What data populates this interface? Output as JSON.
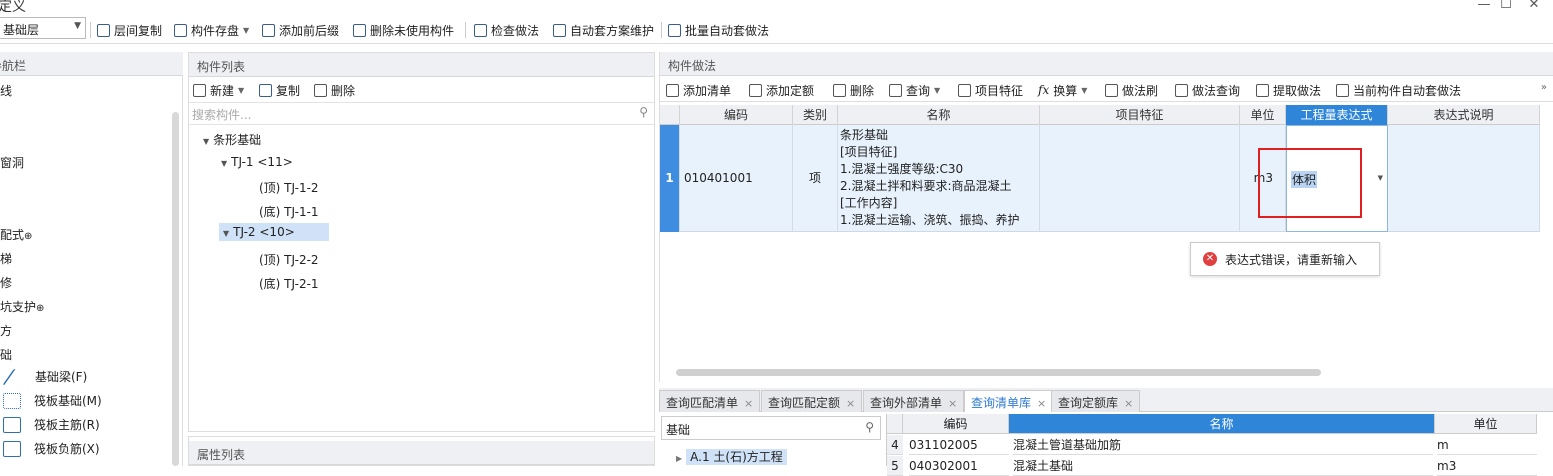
{
  "window": {
    "title": "定义"
  },
  "toolbar": {
    "floor": "基础层",
    "items": [
      "层间复制",
      "构件存盘",
      "添加前后缀",
      "删除未使用构件",
      "检查做法",
      "自动套方案维护",
      "批量自动套做法"
    ]
  },
  "nav": {
    "title": "导航栏",
    "items": [
      "线",
      "窗洞",
      "配式",
      "梯",
      "修",
      "坑支护",
      "方",
      "础"
    ],
    "sub_items": [
      "基础梁(F)",
      "筏板基础(M)",
      "筏板主筋(R)",
      "筏板负筋(X)"
    ]
  },
  "component_list": {
    "title": "构件列表",
    "new_label": "新建",
    "copy_label": "复制",
    "delete_label": "删除",
    "search_placeholder": "搜索构件...",
    "tree": {
      "root": "条形基础",
      "tj1": "TJ-1 <11>",
      "tj1_top": "(顶) TJ-1-2",
      "tj1_bottom": "(底) TJ-1-1",
      "tj2": "TJ-2 <10>",
      "tj2_top": "(顶) TJ-2-2",
      "tj2_bottom": "(底) TJ-2-1"
    }
  },
  "property_list": {
    "title": "属性列表"
  },
  "method": {
    "title": "构件做法",
    "toolbar": [
      "添加清单",
      "添加定额",
      "删除",
      "查询",
      "项目特征",
      "换算",
      "做法刷",
      "做法查询",
      "提取做法",
      "当前构件自动套做法"
    ],
    "columns": [
      "编码",
      "类别",
      "名称",
      "项目特征",
      "单位",
      "工程量表达式",
      "表达式说明"
    ],
    "row": {
      "index": "1",
      "code": "010401001",
      "type": "项",
      "name_lines": [
        "条形基础",
        "[项目特征]",
        "1.混凝土强度等级:C30",
        "2.混凝土拌和料要求:商品混凝土",
        "[工作内容]",
        "1.混凝土运输、浇筑、振捣、养护"
      ],
      "unit": "m3",
      "expression": "体积"
    },
    "error_message": "表达式错误，请重新输入"
  },
  "query_tabs": [
    "查询匹配清单",
    "查询匹配定额",
    "查询外部清单",
    "查询清单库",
    "查询定额库"
  ],
  "library": {
    "search_value": "基础",
    "tree_item": "A.1 土(石)方工程",
    "columns": [
      "编码",
      "名称",
      "单位"
    ],
    "rows": [
      {
        "index": "4",
        "code": "031102005",
        "name": "混凝土管道基础加筋",
        "unit": "m"
      },
      {
        "index": "5",
        "code": "040302001",
        "name": "混凝土基础",
        "unit": "m3"
      }
    ]
  }
}
